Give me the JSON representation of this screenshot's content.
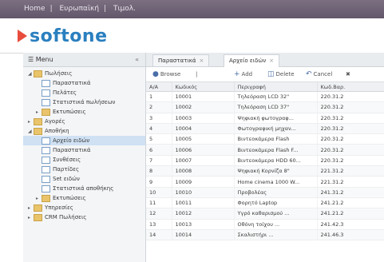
{
  "topbar": {
    "breadcrumbs": [
      "Home",
      "Ευρωπαϊκή",
      "Τιμολ."
    ]
  },
  "brand": {
    "logo_text": "softone",
    "accent": "#e84c3d",
    "color": "#2a7fbf"
  },
  "sidebar": {
    "title": "Menu",
    "items": [
      {
        "label": "Πωλήσεις",
        "icon": "folder-icon",
        "level": 0,
        "expanded": true
      },
      {
        "label": "Παραστατικά",
        "icon": "document-icon",
        "level": 1
      },
      {
        "label": "Πελάτες",
        "icon": "document-icon",
        "level": 1
      },
      {
        "label": "Στατιστικά πωλήσεων",
        "icon": "document-icon",
        "level": 1
      },
      {
        "label": "Εκτυπώσεις",
        "icon": "folder-icon",
        "level": 1
      },
      {
        "label": "Αγορές",
        "icon": "folder-icon",
        "level": 0
      },
      {
        "label": "Αποθήκη",
        "icon": "folder-icon",
        "level": 0,
        "expanded": true
      },
      {
        "label": "Αρχείο ειδών",
        "icon": "document-icon",
        "level": 1,
        "selected": true
      },
      {
        "label": "Παραστατικά",
        "icon": "document-icon",
        "level": 1
      },
      {
        "label": "Συνθέσεις",
        "icon": "document-icon",
        "level": 1
      },
      {
        "label": "Παρτίδες",
        "icon": "document-icon",
        "level": 1
      },
      {
        "label": "Set ειδών",
        "icon": "document-icon",
        "level": 1
      },
      {
        "label": "Στατιστικά αποθήκης",
        "icon": "document-icon",
        "level": 1
      },
      {
        "label": "Εκτυπώσεις",
        "icon": "folder-icon",
        "level": 1
      },
      {
        "label": "Υπηρεσίες",
        "icon": "folder-icon",
        "level": 0
      },
      {
        "label": "CRM Πωλήσεις",
        "icon": "folder-icon",
        "level": 0
      }
    ]
  },
  "tabs": [
    {
      "label": "Παραστατικά",
      "active": false
    },
    {
      "label": "Αρχείο ειδών",
      "active": true
    }
  ],
  "toolbar": {
    "browse": "Browse",
    "add": "Add",
    "delete": "Delete",
    "cancel": "Cancel"
  },
  "table": {
    "columns": [
      "Α/Α",
      "Κωδικός",
      "Περιγραφή",
      "Κωδ.Βαρ."
    ],
    "rows": [
      [
        "1",
        "10001",
        "Τηλεόραση LCD 32\"",
        "220.31.2"
      ],
      [
        "2",
        "10002",
        "Τηλεόραση LCD 37\"",
        "220.31.2"
      ],
      [
        "3",
        "10003",
        "Ψηφιακή φωτογραφ...",
        "220.31.2"
      ],
      [
        "4",
        "10004",
        "Φωτογραφική μηχαν...",
        "220.31.2"
      ],
      [
        "5",
        "10005",
        "Βιντεοκάμερα Flash",
        "220.31.2"
      ],
      [
        "6",
        "10006",
        "Βιντεοκάμερα Flash F...",
        "220.31.2"
      ],
      [
        "7",
        "10007",
        "Βιντεοκάμερα HDD 60...",
        "220.31.2"
      ],
      [
        "8",
        "10008",
        "Ψηφιακή Κορνίζα 8\"",
        "221.31.2"
      ],
      [
        "9",
        "10009",
        "Home cinema 1000 W...",
        "221.31.2"
      ],
      [
        "10",
        "10010",
        "Προβολέας",
        "241.31.2"
      ],
      [
        "11",
        "10011",
        "Φορητό Laptop",
        "241.21.2"
      ],
      [
        "12",
        "10012",
        "Υγρό καθαρισμού ...",
        "241.21.2"
      ],
      [
        "13",
        "10013",
        "Οθόνη τοίχου ...",
        "241.42.3"
      ],
      [
        "14",
        "10014",
        "Σκαλιστήρι ...",
        "241.46.3"
      ]
    ]
  }
}
